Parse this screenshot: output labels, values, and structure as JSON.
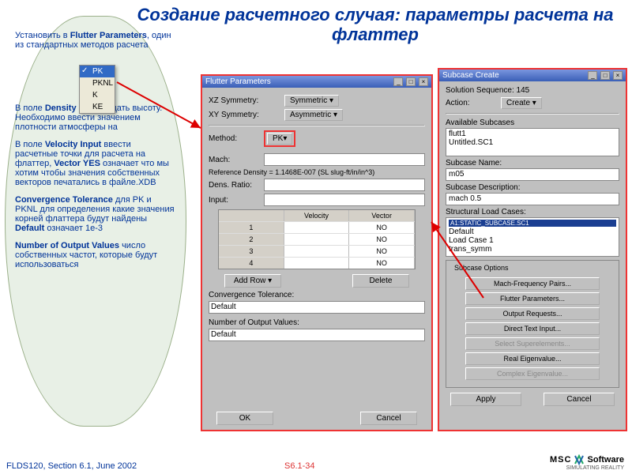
{
  "title": "Создание расчетного случая: параметры расчета на флаттер",
  "left": {
    "p1a": "Установить в ",
    "p1b": "Flutter Parameters",
    "p1c": ", один из стандартных методов расчета",
    "p2a": "В поле ",
    "p2b": "Density Ratio",
    "p2c": " задать высоту. Необходимо ввести значением плотности атмосферы на",
    "p3a": "В поле ",
    "p3b": "Velocity Input",
    "p3c": " ввести расчетные точки для расчета на флаттер, ",
    "p3d": "Vector YES",
    "p3e": " означает что мы хотим чтобы значения собственных векторов печатались в файле.XDB",
    "p4a": "Convergence Tolerance",
    "p4b": " для PK и PKNL для определения какие значения корней флаттера будут найдены ",
    "p4c": "Default",
    "p4d": " означает 1e-3",
    "p5a": "Number of Output Values",
    "p5b": " число собственных частот, которые будут использоваться"
  },
  "menu": {
    "items": [
      "PK",
      "PKNL",
      "K",
      "KE"
    ]
  },
  "flutter": {
    "title": "Flutter Parameters",
    "xz_label": "XZ Symmetry:",
    "xz_val": "Symmetric ▾",
    "xy_label": "XY Symmetry:",
    "xy_val": "Asymmetric ▾",
    "method_label": "Method:",
    "method_val": "PK▾",
    "mach_label": "Mach:",
    "refdens": "Reference Density = 1.1468E-007  (SL slug-ft/in/in^3)",
    "dens_label": "Dens. Ratio:",
    "input_label": "Input:",
    "col_vel": "Velocity",
    "col_vec": "Vector",
    "no": "NO",
    "addrow": "Add Row ▾",
    "delete": "Delete",
    "convtol_label": "Convergence Tolerance:",
    "default": "Default",
    "nov_label": "Number of Output Values:",
    "ok": "OK",
    "cancel": "Cancel"
  },
  "subcase": {
    "title": "Subcase Create",
    "seq": "Solution Sequence: 145",
    "action_label": "Action:",
    "action_val": "Create ▾",
    "avail": "Available Subcases",
    "avail_items": [
      "flutt1",
      "Untitled.SC1"
    ],
    "name_label": "Subcase Name:",
    "name_val": "m05",
    "desc_label": "Subcase Description:",
    "desc_val": "mach 0.5",
    "slc_label": "Structural Load Cases:",
    "slc_hl": "A1:STATIC_SUBCASE.SC1",
    "slc_items": [
      "Default",
      "Load Case 1",
      "trans_symm"
    ],
    "opts_legend": "Subcase Options",
    "btn_mach": "Mach-Frequency Pairs...",
    "btn_flutter": "Flutter Parameters...",
    "btn_output": "Output Requests...",
    "btn_direct": "Direct Text Input...",
    "btn_super": "Select Superelements...",
    "btn_real": "Real Eigenvalue...",
    "btn_complex": "Complex Eigenvalue...",
    "apply": "Apply",
    "cancel": "Cancel"
  },
  "footer": "FLDS120, Section 6.1, June 2002",
  "section_mark": "S6.1-34",
  "logo": {
    "msc": "MSC",
    "software": "Software",
    "tag": "SIMULATING REALITY"
  }
}
